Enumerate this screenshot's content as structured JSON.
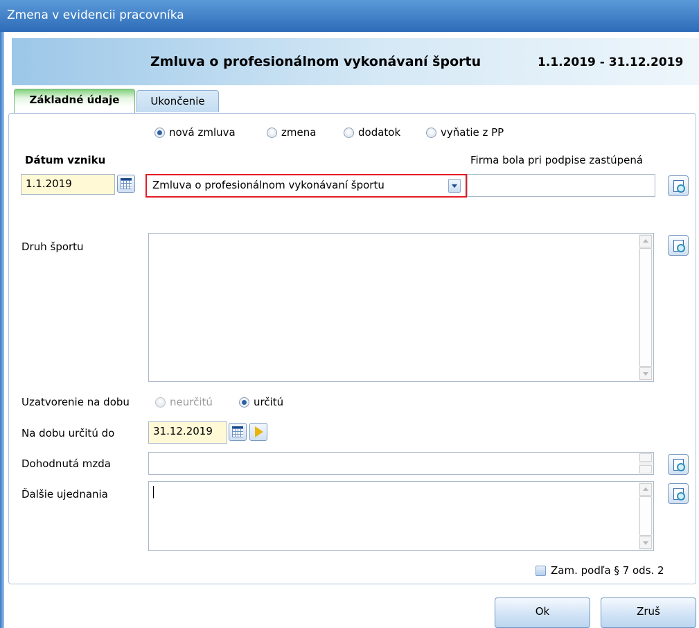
{
  "window": {
    "title": "Zmena v evidencii pracovníka"
  },
  "banner": {
    "title": "Zmluva o profesionálnom vykonávaní športu",
    "period": "1.1.2019 - 31.12.2019"
  },
  "tabs": [
    {
      "label": "Základné údaje",
      "active": true
    },
    {
      "label": "Ukončenie",
      "active": false
    }
  ],
  "contract_type_options": [
    {
      "label": "nová zmluva",
      "selected": true
    },
    {
      "label": "zmena",
      "selected": false
    },
    {
      "label": "dodatok",
      "selected": false
    },
    {
      "label": "vyňatie z PP",
      "selected": false
    }
  ],
  "fields": {
    "date_origin_label": "Dátum vzniku",
    "date_origin_value": "1.1.2019",
    "contract_combo_value": "Zmluva o profesionálnom vykonávaní športu",
    "representation_label": "Firma bola pri podpise zastúpená",
    "representation_value": "",
    "sport_type_label": "Druh športu",
    "sport_type_value": "",
    "duration_label": "Uzatvorenie na dobu",
    "duration_options": [
      {
        "label": "neurčitú",
        "selected": false,
        "disabled": true
      },
      {
        "label": "určitú",
        "selected": true,
        "disabled": false
      }
    ],
    "fixed_until_label": "Na dobu určitú do",
    "fixed_until_value": "31.12.2019",
    "agreed_wage_label": "Dohodnutá mzda",
    "agreed_wage_value": "",
    "other_terms_label": "Ďalšie ujednania",
    "other_terms_value": ""
  },
  "checkbox": {
    "label": "Zam. podľa § 7 ods. 2",
    "checked": false
  },
  "buttons": {
    "ok": "Ok",
    "cancel": "Zruš"
  },
  "colors": {
    "highlight": "#e41b23",
    "date_field_bg": "#fff9d6",
    "titlebar": "#3b7cc4"
  }
}
